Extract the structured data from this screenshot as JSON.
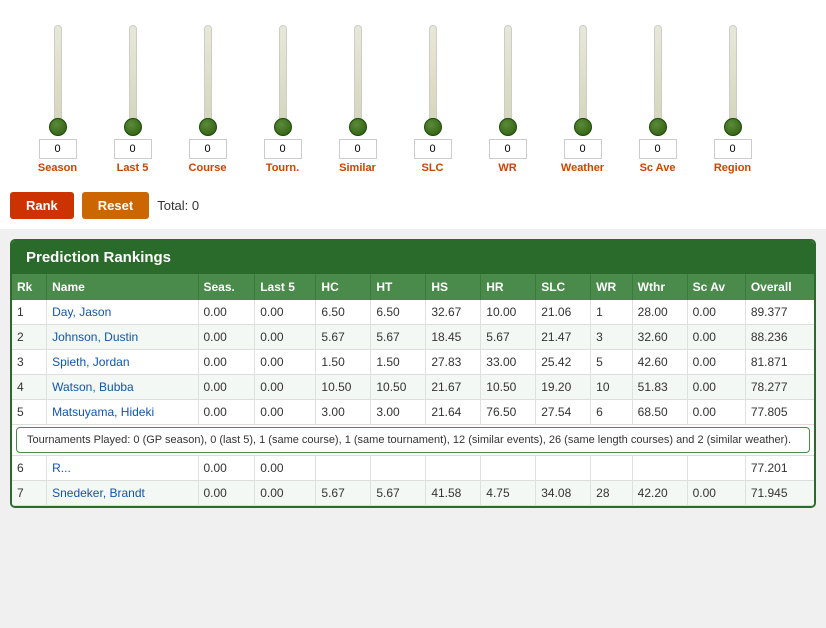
{
  "sliders": [
    {
      "id": "season",
      "label": "Season",
      "value": "0"
    },
    {
      "id": "last5",
      "label": "Last 5",
      "value": "0"
    },
    {
      "id": "course",
      "label": "Course",
      "value": "0"
    },
    {
      "id": "tourn",
      "label": "Tourn.",
      "value": "0"
    },
    {
      "id": "similar",
      "label": "Similar",
      "value": "0"
    },
    {
      "id": "slc",
      "label": "SLC",
      "value": "0"
    },
    {
      "id": "wr",
      "label": "WR",
      "value": "0"
    },
    {
      "id": "weather",
      "label": "Weather",
      "value": "0"
    },
    {
      "id": "sc_ave",
      "label": "Sc Ave",
      "value": "0"
    },
    {
      "id": "region",
      "label": "Region",
      "value": "0"
    }
  ],
  "buttons": {
    "rank": "Rank",
    "reset": "Reset",
    "total_label": "Total:",
    "total_value": "0"
  },
  "table": {
    "title": "Prediction Rankings",
    "headers": [
      "Rk",
      "Name",
      "Seas.",
      "Last 5",
      "HC",
      "HT",
      "HS",
      "HR",
      "SLC",
      "WR",
      "Wthr",
      "Sc Av",
      "Overall"
    ],
    "rows": [
      {
        "rk": "1",
        "name": "Day, Jason",
        "seas": "0.00",
        "last5": "0.00",
        "hc": "6.50",
        "ht": "6.50",
        "hs": "32.67",
        "hr": "10.00",
        "slc": "21.06",
        "wr": "1",
        "wthr": "28.00",
        "scav": "0.00",
        "overall": "89.377"
      },
      {
        "rk": "2",
        "name": "Johnson, Dustin",
        "seas": "0.00",
        "last5": "0.00",
        "hc": "5.67",
        "ht": "5.67",
        "hs": "18.45",
        "hr": "5.67",
        "slc": "21.47",
        "wr": "3",
        "wthr": "32.60",
        "scav": "0.00",
        "overall": "88.236"
      },
      {
        "rk": "3",
        "name": "Spieth, Jordan",
        "seas": "0.00",
        "last5": "0.00",
        "hc": "1.50",
        "ht": "1.50",
        "hs": "27.83",
        "hr": "33.00",
        "slc": "25.42",
        "wr": "5",
        "wthr": "42.60",
        "scav": "0.00",
        "overall": "81.871"
      },
      {
        "rk": "4",
        "name": "Watson, Bubba",
        "seas": "0.00",
        "last5": "0.00",
        "hc": "10.50",
        "ht": "10.50",
        "hs": "21.67",
        "hr": "10.50",
        "slc": "19.20",
        "wr": "10",
        "wthr": "51.83",
        "scav": "0.00",
        "overall": "78.277"
      },
      {
        "rk": "5",
        "name": "Matsuyama, Hideki",
        "seas": "0.00",
        "last5": "0.00",
        "hc": "3.00",
        "ht": "3.00",
        "hs": "21.64",
        "hr": "76.50",
        "slc": "27.54",
        "wr": "6",
        "wthr": "68.50",
        "scav": "0.00",
        "overall": "77.805"
      },
      {
        "rk": "tooltip",
        "name": "",
        "seas": "",
        "last5": "",
        "hc": "",
        "ht": "",
        "hs": "",
        "hr": "",
        "slc": "",
        "wr": "",
        "wthr": "",
        "scav": "",
        "overall": ""
      },
      {
        "rk": "6",
        "name": "R...",
        "seas": "0.00",
        "last5": "0.00",
        "hc": "",
        "ht": "",
        "hs": "",
        "hr": "",
        "slc": "",
        "wr": "",
        "wthr": "",
        "scav": "",
        "overall": "77.201"
      },
      {
        "rk": "7",
        "name": "Snedeker, Brandt",
        "seas": "0.00",
        "last5": "0.00",
        "hc": "5.67",
        "ht": "5.67",
        "hs": "41.58",
        "hr": "4.75",
        "slc": "34.08",
        "wr": "28",
        "wthr": "42.20",
        "scav": "0.00",
        "overall": "71.945"
      }
    ],
    "tooltip_text": "Tournaments Played: 0 (GP season), 0 (last 5), 1 (same course), 1 (same tournament), 12 (similar events), 26 (same length courses) and 2 (similar weather)."
  }
}
